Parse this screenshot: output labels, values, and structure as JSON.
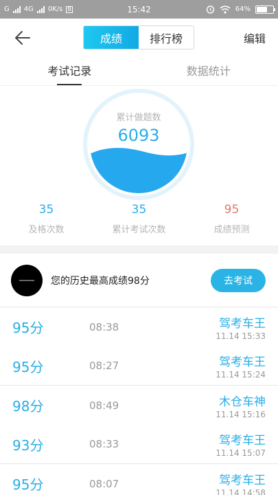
{
  "status_bar": {
    "carrier_1": "G",
    "carrier_2": "4G",
    "speed": "0K/s",
    "data_icon": "B",
    "time": "15:42",
    "battery": "64%",
    "battery_level": 0.64
  },
  "nav": {
    "segments": [
      "成绩",
      "排行榜"
    ],
    "edit": "编辑"
  },
  "tabs": [
    "考试记录",
    "数据统计"
  ],
  "summary": {
    "label": "累计做题数",
    "value": "6093",
    "stats": [
      {
        "value": "35",
        "label": "及格次数"
      },
      {
        "value": "35",
        "label": "累计考试次数"
      },
      {
        "value": "95",
        "label": "成绩预测"
      }
    ]
  },
  "best": {
    "text": "您的历史最高成绩98分",
    "button": "去考试"
  },
  "records": [
    {
      "score": "95分",
      "duration": "08:38",
      "title": "驾考车王",
      "date": "11.14  15:33"
    },
    {
      "score": "95分",
      "duration": "08:27",
      "title": "驾考车王",
      "date": "11.14  15:24"
    },
    {
      "score": "98分",
      "duration": "08:49",
      "title": "木仓车神",
      "date": "11.14  15:16"
    },
    {
      "score": "93分",
      "duration": "08:33",
      "title": "驾考车王",
      "date": "11.14  15:07"
    },
    {
      "score": "95分",
      "duration": "08:07",
      "title": "驾考车王",
      "date": "11.14  14:58"
    }
  ],
  "colors": {
    "accent": "#29aee8",
    "prediction": "#e07b6b",
    "status_bar": "#9e9e9e"
  }
}
